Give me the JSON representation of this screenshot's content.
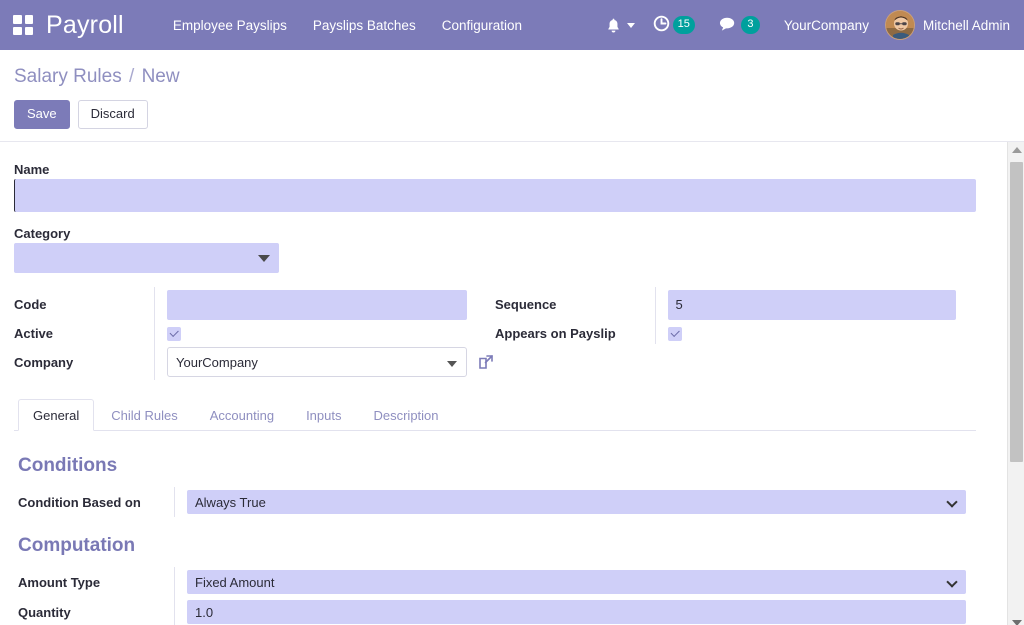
{
  "navbar": {
    "apps_icon": "apps-grid-icon",
    "brand": "Payroll",
    "menu": [
      {
        "label": "Employee Payslips"
      },
      {
        "label": "Payslips Batches"
      },
      {
        "label": "Configuration"
      }
    ],
    "bell_icon": "bell-icon",
    "activity_icon": "clock-activity-icon",
    "activity_count": "15",
    "messages_icon": "messages-icon",
    "messages_count": "3",
    "company": "YourCompany",
    "user_name": "Mitchell Admin",
    "avatar_icon": "user-avatar",
    "badge_color": "#00a09d",
    "navbar_color": "#7c7bb8"
  },
  "control_panel": {
    "breadcrumb_root": "Salary Rules",
    "breadcrumb_sep": "/",
    "breadcrumb_current": "New",
    "save_label": "Save",
    "discard_label": "Discard",
    "primary_color": "#7c7bb8"
  },
  "form": {
    "name": {
      "label": "Name",
      "value": "",
      "placeholder": ""
    },
    "category": {
      "label": "Category",
      "value": ""
    },
    "code": {
      "label": "Code",
      "value": ""
    },
    "active": {
      "label": "Active",
      "checked": "true"
    },
    "company": {
      "label": "Company",
      "value": "YourCompany",
      "external_link_icon": "external-link-icon"
    },
    "sequence": {
      "label": "Sequence",
      "value": "5"
    },
    "appears_on_payslip": {
      "label": "Appears on Payslip",
      "checked": "true"
    }
  },
  "notebook": {
    "tabs": [
      {
        "label": "General",
        "active": "true"
      },
      {
        "label": "Child Rules",
        "active": "false"
      },
      {
        "label": "Accounting",
        "active": "false"
      },
      {
        "label": "Inputs",
        "active": "false"
      },
      {
        "label": "Description",
        "active": "false"
      }
    ],
    "general": {
      "conditions_title": "Conditions",
      "condition_based_on": {
        "label": "Condition Based on",
        "value": "Always True"
      },
      "computation_title": "Computation",
      "amount_type": {
        "label": "Amount Type",
        "value": "Fixed Amount"
      },
      "quantity": {
        "label": "Quantity",
        "value": "1.0"
      }
    }
  },
  "scrollbar": {
    "up_icon": "scroll-up-arrow-icon",
    "down_icon": "scroll-down-arrow-icon"
  }
}
